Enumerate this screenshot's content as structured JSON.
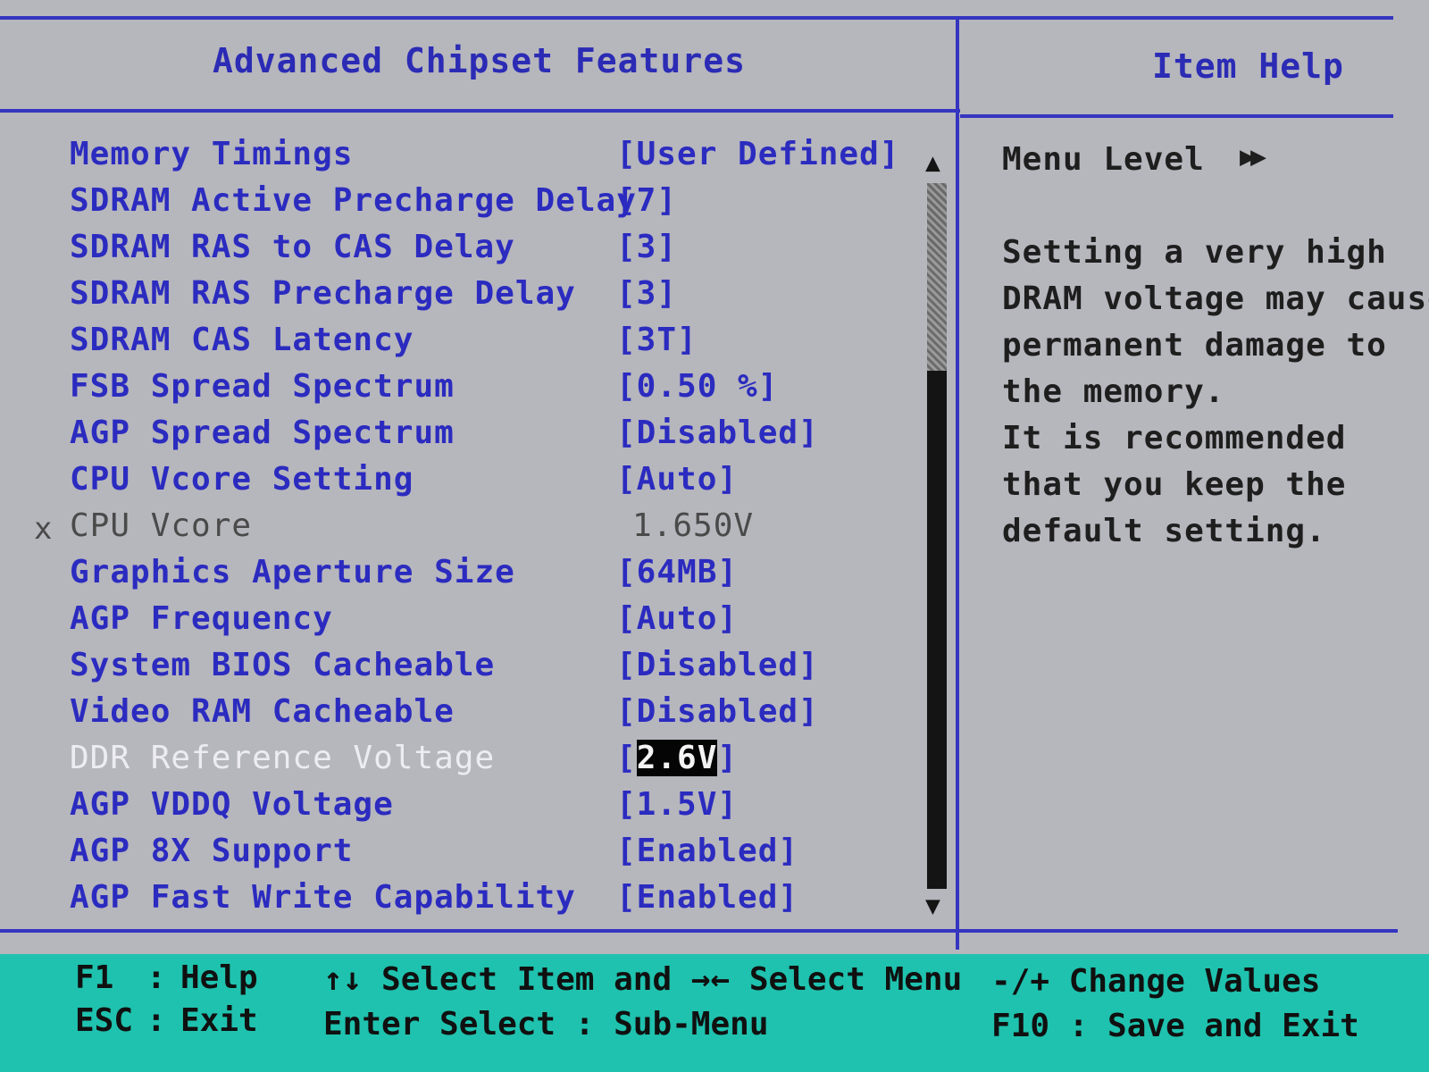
{
  "screen": {
    "title": "Advanced Chipset Features",
    "help_title": "Item Help"
  },
  "settings": [
    {
      "label": "Memory Timings",
      "value": "[User Defined]"
    },
    {
      "label": "SDRAM Active Precharge Delay",
      "value": "[7]"
    },
    {
      "label": "SDRAM RAS to CAS Delay",
      "value": "[3]"
    },
    {
      "label": "SDRAM RAS Precharge Delay",
      "value": "[3]"
    },
    {
      "label": "SDRAM CAS Latency",
      "value": "[3T]"
    },
    {
      "label": "FSB Spread Spectrum",
      "value": "[0.50 %]"
    },
    {
      "label": "AGP Spread Spectrum",
      "value": "[Disabled]"
    },
    {
      "label": "CPU Vcore Setting",
      "value": "[Auto]"
    },
    {
      "label": "CPU Vcore",
      "value": "1.650V",
      "mark": "x"
    },
    {
      "label": "Graphics Aperture Size",
      "value": "[64MB]"
    },
    {
      "label": "AGP Frequency",
      "value": "[Auto]"
    },
    {
      "label": "System BIOS Cacheable",
      "value": "[Disabled]"
    },
    {
      "label": "Video RAM Cacheable",
      "value": "[Disabled]"
    },
    {
      "label": "DDR Reference Voltage",
      "value_open": "[",
      "value_core": "2.6V",
      "value_close": "]"
    },
    {
      "label": "AGP VDDQ Voltage",
      "value": "[1.5V]"
    },
    {
      "label": "AGP 8X Support",
      "value": "[Enabled]"
    },
    {
      "label": "AGP Fast Write Capability",
      "value": "[Enabled]"
    }
  ],
  "scrollbar": {
    "up_arrow": "▲",
    "down_arrow": "▼"
  },
  "help": {
    "menu_level_label": "Menu Level",
    "menu_level_glyph": "▶▶",
    "text_lines": [
      "Setting a very high",
      "DRAM voltage may cause",
      "permanent damage to",
      "the memory.",
      "It is recommended",
      "that you keep the",
      "default setting."
    ]
  },
  "footer": {
    "f1_key": "F1",
    "f1_sep": ":",
    "f1_action": "Help",
    "esc_key": "ESC",
    "esc_sep": ":",
    "esc_action": "Exit",
    "nav_line1": "↑↓ Select Item and →← Select Menu",
    "nav_line2": "Enter Select : Sub-Menu",
    "change_values": "-/+ Change Values",
    "f10": "F10 : Save and Exit"
  },
  "colors": {
    "background": "#b6b6bd",
    "frame": "#3535c0",
    "item_text": "#2b2bc0",
    "disabled_text": "#4a4a4a",
    "selected_text": "#ececf2",
    "footer_bg": "#1fc2ae"
  }
}
